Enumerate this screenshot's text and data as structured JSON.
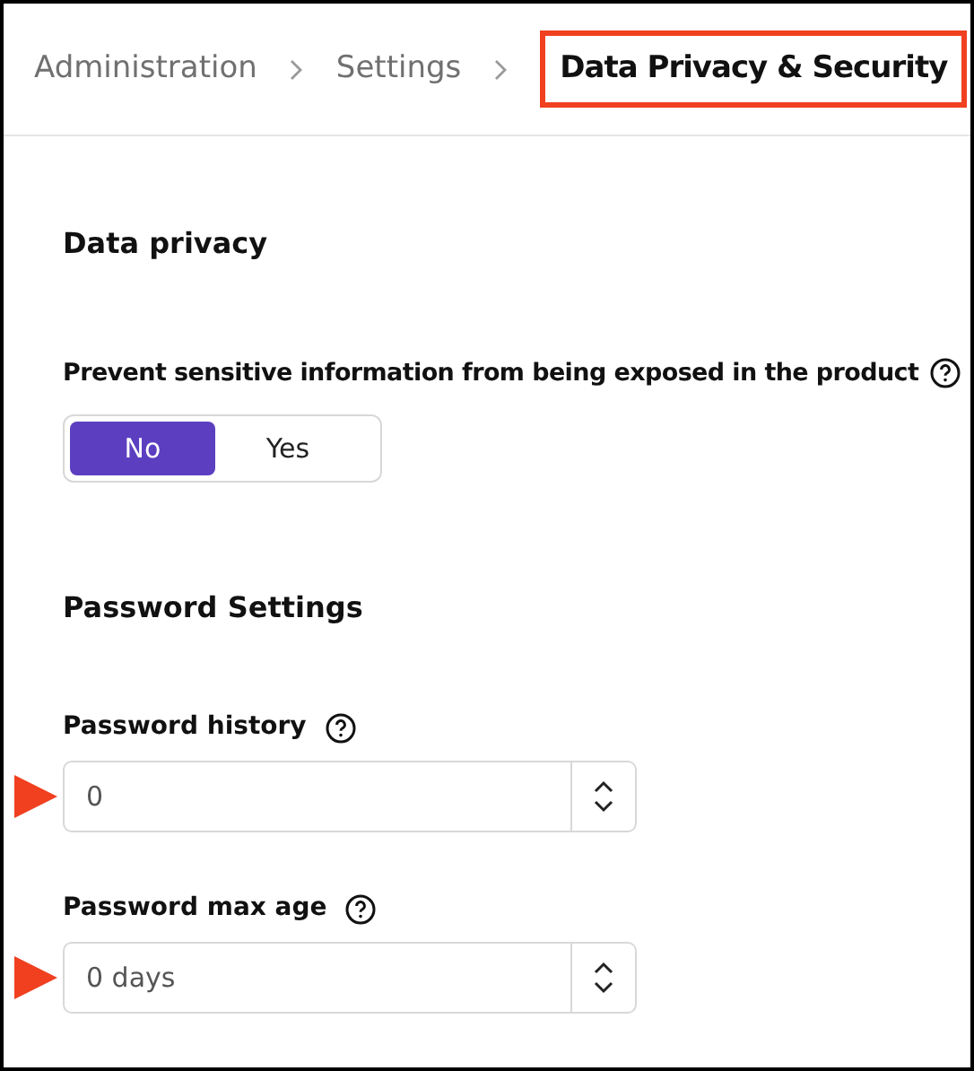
{
  "breadcrumb": [
    {
      "label": "Administration",
      "current": false,
      "highlighted": false
    },
    {
      "label": "Settings",
      "current": false,
      "highlighted": false
    },
    {
      "label": "Data Privacy & Security",
      "current": true,
      "highlighted": true
    }
  ],
  "data_privacy": {
    "title": "Data privacy",
    "question": "Prevent sensitive information from being exposed in the product",
    "options": [
      {
        "label": "No",
        "selected": true
      },
      {
        "label": "Yes",
        "selected": false
      }
    ]
  },
  "password_settings": {
    "title": "Password Settings",
    "fields": [
      {
        "label": "Password history",
        "value": "0",
        "marked": true
      },
      {
        "label": "Password max age",
        "value": "0 days",
        "marked": true
      }
    ]
  }
}
